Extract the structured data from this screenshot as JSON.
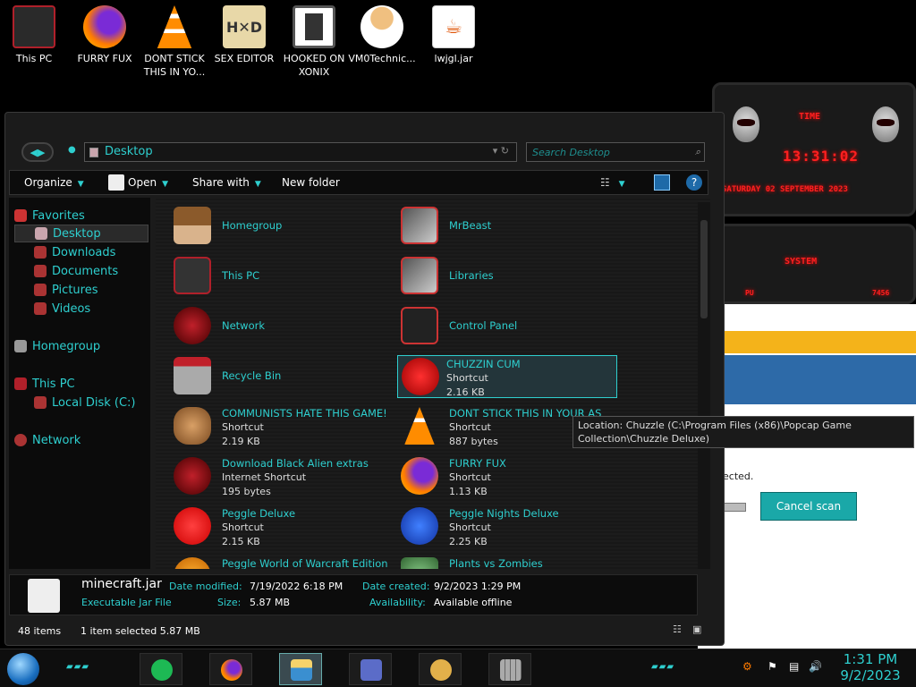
{
  "desktop_icons": [
    {
      "label": "This PC",
      "icon": "this-pc-icon",
      "color": "#b0202a"
    },
    {
      "label": "FURRY FUX",
      "icon": "firefox-icon",
      "color": "#ff7b00"
    },
    {
      "label": "DONT STICK THIS IN YO...",
      "icon": "vlc-cone-icon",
      "color": "#ff8c00"
    },
    {
      "label": "SEX EDITOR",
      "icon": "hxd-editor-icon",
      "color": "#e8d8a8"
    },
    {
      "label": "HOOKED ON XONIX",
      "icon": "xonix-game-icon",
      "color": "#555555"
    },
    {
      "label": "VM0Technic...",
      "icon": "doctor-icon",
      "color": "#f0c080"
    },
    {
      "label": "lwjgl.jar",
      "icon": "java-jar-icon",
      "color": "#ffffff"
    }
  ],
  "explorer": {
    "address": "Desktop",
    "search_placeholder": "Search Desktop",
    "toolbar": {
      "organize": "Organize",
      "open": "Open",
      "share_with": "Share with",
      "new_folder": "New folder"
    },
    "nav": {
      "favorites": "Favorites",
      "desktop": "Desktop",
      "downloads": "Downloads",
      "documents": "Documents",
      "pictures": "Pictures",
      "videos": "Videos",
      "homegroup": "Homegroup",
      "this_pc": "This PC",
      "local_disk": "Local Disk (C:)",
      "network": "Network"
    },
    "items_left": [
      {
        "name": "Homegroup",
        "line1": "",
        "line2": "",
        "icon": "homegroup-icon"
      },
      {
        "name": "This PC",
        "line1": "",
        "line2": "",
        "icon": "this-pc-icon"
      },
      {
        "name": "Network",
        "line1": "",
        "line2": "",
        "icon": "network-icon"
      },
      {
        "name": "Recycle Bin",
        "line1": "",
        "line2": "",
        "icon": "recycle-bin-icon"
      },
      {
        "name": "COMMUNISTS HATE THIS GAME!",
        "line1": "Shortcut",
        "line2": "2.19 KB",
        "icon": "money-bag-icon"
      },
      {
        "name": "Download Black Alien extras",
        "line1": "Internet Shortcut",
        "line2": "195 bytes",
        "icon": "network-icon"
      },
      {
        "name": "Peggle Deluxe",
        "line1": "Shortcut",
        "line2": "2.15 KB",
        "icon": "peggle-icon"
      },
      {
        "name": "Peggle World of Warcraft Edition",
        "line1": "",
        "line2": "",
        "icon": "peggle-icon"
      }
    ],
    "items_right": [
      {
        "name": "MrBeast",
        "line1": "",
        "line2": "",
        "icon": "folder-icon"
      },
      {
        "name": "Libraries",
        "line1": "",
        "line2": "",
        "icon": "libraries-icon"
      },
      {
        "name": "Control Panel",
        "line1": "",
        "line2": "",
        "icon": "control-panel-icon"
      },
      {
        "name": "CHUZZIN CUM",
        "line1": "Shortcut",
        "line2": "2.16 KB",
        "icon": "chuzzle-icon"
      },
      {
        "name": "DONT STICK THIS IN YOUR AS",
        "line1": "Shortcut",
        "line2": "887 bytes",
        "icon": "vlc-cone-icon"
      },
      {
        "name": "FURRY FUX",
        "line1": "Shortcut",
        "line2": "1.13 KB",
        "icon": "firefox-icon"
      },
      {
        "name": "Peggle Nights Deluxe",
        "line1": "Shortcut",
        "line2": "2.25 KB",
        "icon": "peggle-icon"
      },
      {
        "name": "Plants vs Zombies",
        "line1": "",
        "line2": "",
        "icon": "plants-vs-zombies-icon"
      }
    ],
    "tooltip": "Location: Chuzzle (C:\\Program Files (x86)\\Popcap Game Collection\\Chuzzle Deluxe)",
    "details": {
      "filename": "minecraft.jar",
      "filetype": "Executable Jar File",
      "date_modified_label": "Date modified:",
      "date_modified": "7/19/2022 6:18 PM",
      "size_label": "Size:",
      "size": "5.87 MB",
      "date_created_label": "Date created:",
      "date_created": "9/2/2023 1:29 PM",
      "availability_label": "Availability:",
      "availability": "Available offline"
    },
    "status": {
      "count": "48 items",
      "selected": "1 item selected  5.87 MB"
    }
  },
  "widgets": {
    "time_label": "TIME",
    "time": "13:31:02",
    "date": "SATURDAY 02 SEPTEMBER 2023",
    "system_label": "SYSTEM",
    "cpu_label": "PU",
    "mem_value": "7456"
  },
  "background_app": {
    "status_text": "ected.",
    "cancel_button": "Cancel scan"
  },
  "taskbar": {
    "apps": [
      "spotify-icon",
      "firefox-icon",
      "file-explorer-icon",
      "id-card-icon",
      "handshake-icon",
      "castle-wall-icon"
    ],
    "time": "1:31 PM",
    "date": "9/2/2023"
  },
  "colors": {
    "accent": "#2ecfcf",
    "widget_red": "#ff2020",
    "background": "#000000"
  }
}
